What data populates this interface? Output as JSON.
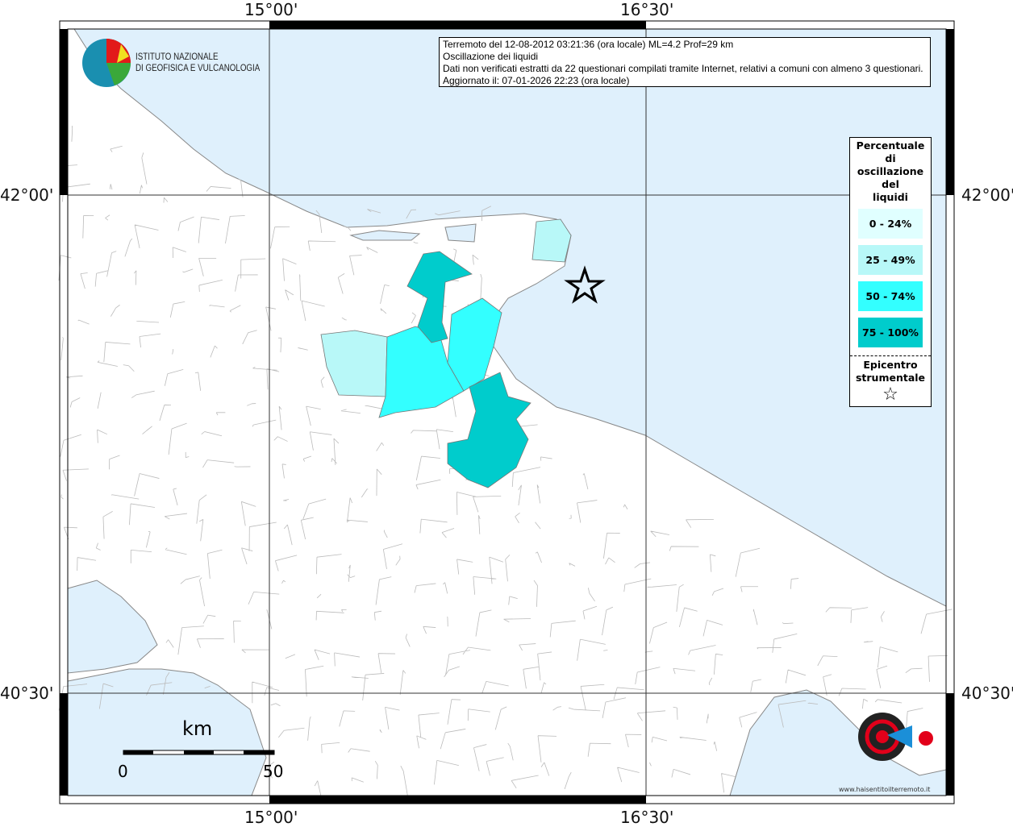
{
  "coords": {
    "lon": [
      "15°00'",
      "16°30'"
    ],
    "lat": [
      "42°00'",
      "40°30'"
    ]
  },
  "title": {
    "line1": "Terremoto del 12-08-2012 03:21:36 (ora locale) ML=4.2 Prof=29 km",
    "line2": "Oscillazione dei liquidi",
    "line3": "Dati non verificati estratti da 22 questionari compilati tramite Internet, relativi a comuni con almeno 3 questionari.",
    "line4": "Aggiornato il: 07-01-2026 22:23 (ora locale)"
  },
  "logo": {
    "line1": "ISTITUTO NAZIONALE",
    "line2": "DI GEOFISICA E VULCANOLOGIA",
    "hsit": "www.haisentitoilterremoto.it"
  },
  "legend": {
    "title": [
      "Percentuale",
      "di",
      "oscillazione",
      "del",
      "liquidi"
    ],
    "classes": [
      {
        "label": "0 - 24%",
        "color": "#e0ffff"
      },
      {
        "label": "25 - 49%",
        "color": "#b8f8f8"
      },
      {
        "label": "50 - 74%",
        "color": "#33ffff"
      },
      {
        "label": "75 - 100%",
        "color": "#00cccc"
      }
    ],
    "epicenter_label": [
      "Epicentro",
      "strumentale"
    ],
    "epicenter_icon": "star-icon"
  },
  "scale": {
    "unit": "km",
    "min": "0",
    "max": "50"
  },
  "colors": {
    "sea": "#dff0fc",
    "land": "#ffffff"
  }
}
